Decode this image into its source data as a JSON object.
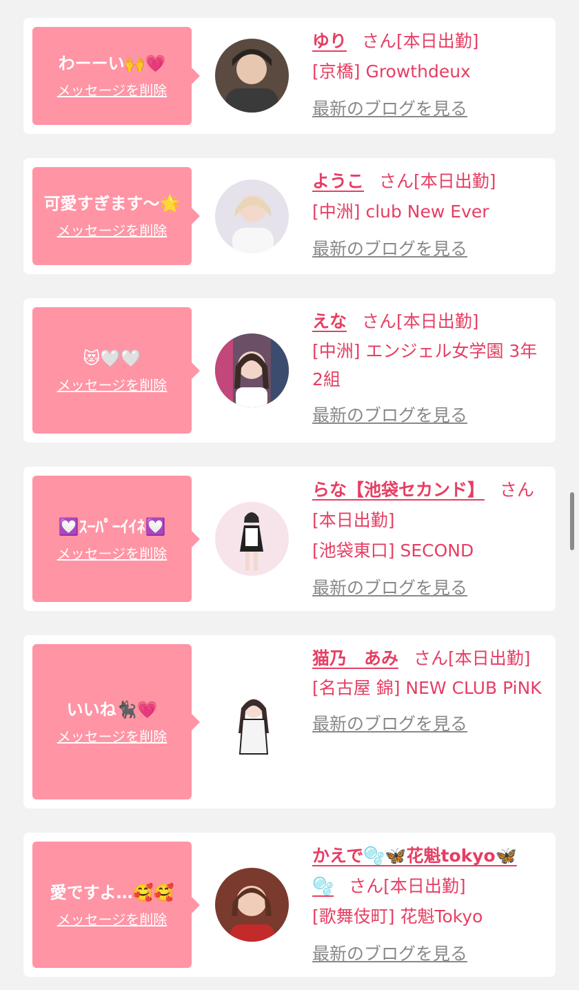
{
  "delete_label": "メッセージを削除",
  "blog_label": "最新のブログを見る",
  "san_label": "さん",
  "colors": {
    "accent": "#e63e63",
    "bubble": "#ff94a4",
    "blog_link": "#888888",
    "background": "#f2f2f2"
  },
  "messages": [
    {
      "message": "わーーい🙌💗",
      "name": "ゆり",
      "status": "[本日出勤]",
      "area": "[京橋] Growthdeux",
      "avatar_icon": "person-avatar-icon"
    },
    {
      "message": "可愛すぎます〜🌟",
      "name": "ようこ",
      "status": "[本日出勤]",
      "area": "[中洲] club New Ever",
      "avatar_icon": "person-avatar-icon"
    },
    {
      "message": "😻🤍🤍",
      "name": "えな",
      "status": "[本日出勤]",
      "area": "[中洲] エンジェル女学園 3年2組",
      "avatar_icon": "person-avatar-icon"
    },
    {
      "message": "💟ｽｰﾊﾟｰｲｲﾈ💟",
      "name": "らな【池袋セカンド】",
      "status": "[本日出勤]",
      "area": "[池袋東口] SECOND",
      "avatar_icon": "person-avatar-icon"
    },
    {
      "message": "いいね🐈‍⬛💗",
      "name": "猫乃　あみ",
      "status": "[本日出勤]",
      "area": "[名古屋 錦] NEW CLUB PiNK",
      "avatar_icon": "person-avatar-icon"
    },
    {
      "message": "愛ですよ…🥰🥰",
      "name": "かえで🫧🦋花魁tokyo🦋🫧",
      "status": "[本日出勤]",
      "area": "[歌舞伎町] 花魁Tokyo",
      "avatar_icon": "person-avatar-icon"
    }
  ]
}
